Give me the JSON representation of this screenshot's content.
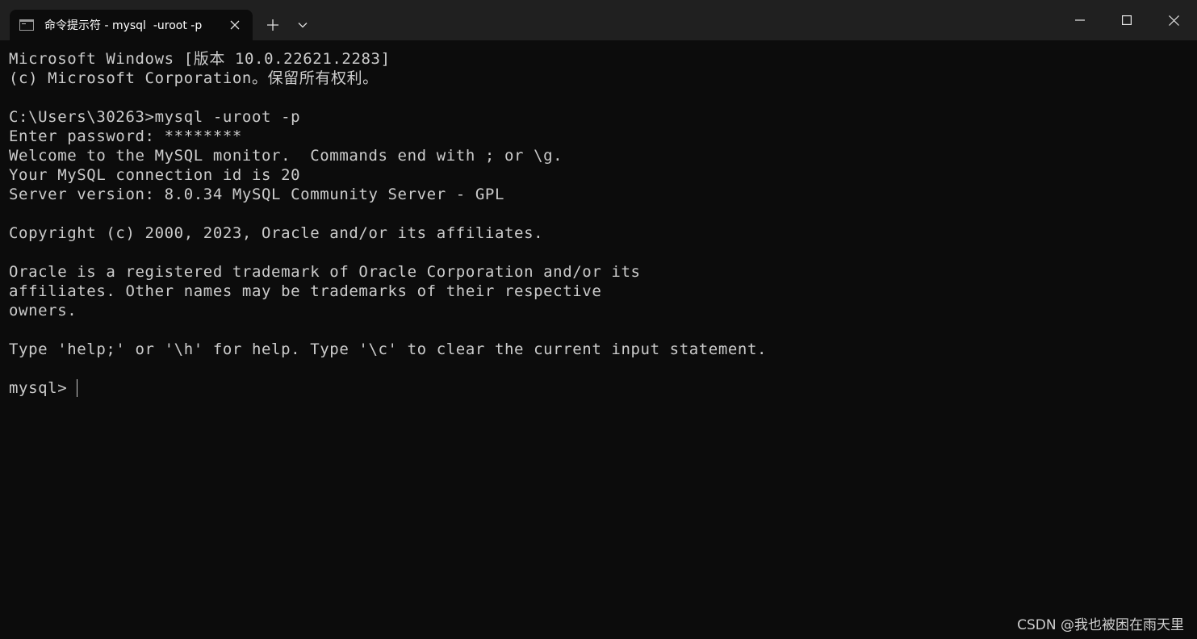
{
  "window": {
    "tab_title": "命令提示符 - mysql  -uroot -p",
    "tab_icon": "cmd-icon",
    "new_tab_icon": "plus-icon",
    "dropdown_icon": "chevron-down-icon",
    "minimize_icon": "minimize-icon",
    "maximize_icon": "maximize-icon",
    "close_icon": "close-icon"
  },
  "terminal": {
    "lines": [
      "Microsoft Windows [版本 10.0.22621.2283]",
      "(c) Microsoft Corporation。保留所有权利。",
      "",
      "C:\\Users\\30263>mysql -uroot -p",
      "Enter password: ********",
      "Welcome to the MySQL monitor.  Commands end with ; or \\g.",
      "Your MySQL connection id is 20",
      "Server version: 8.0.34 MySQL Community Server - GPL",
      "",
      "Copyright (c) 2000, 2023, Oracle and/or its affiliates.",
      "",
      "Oracle is a registered trademark of Oracle Corporation and/or its",
      "affiliates. Other names may be trademarks of their respective",
      "owners.",
      "",
      "Type 'help;' or '\\h' for help. Type '\\c' to clear the current input statement.",
      ""
    ],
    "prompt": "mysql>"
  },
  "watermark": "CSDN @我也被困在雨天里",
  "colors": {
    "background": "#0c0c0c",
    "titlebar": "#202020",
    "text": "#cccccc"
  }
}
